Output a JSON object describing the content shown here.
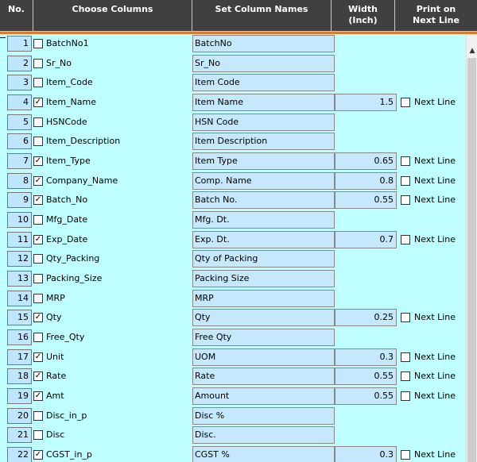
{
  "headers": {
    "no": "No.",
    "choose": "Choose Columns",
    "set_names": "Set Column Names",
    "width_l1": "Width",
    "width_l2": "(Inch)",
    "print_l1": "Print on",
    "print_l2": "Next Line"
  },
  "next_line_label": "Next Line",
  "rows": [
    {
      "no": "1",
      "checked": false,
      "column": "BatchNo1",
      "name": "BatchNo",
      "width": null
    },
    {
      "no": "2",
      "checked": false,
      "column": "Sr_No",
      "name": "Sr_No",
      "width": null
    },
    {
      "no": "3",
      "checked": false,
      "column": "Item_Code",
      "name": "Item Code",
      "width": null
    },
    {
      "no": "4",
      "checked": true,
      "column": "Item_Name",
      "name": "Item Name",
      "width": "1.5"
    },
    {
      "no": "5",
      "checked": false,
      "column": "HSNCode",
      "name": "HSN Code",
      "width": null
    },
    {
      "no": "6",
      "checked": false,
      "column": "Item_Description",
      "name": "Item Description",
      "width": null
    },
    {
      "no": "7",
      "checked": true,
      "column": "Item_Type",
      "name": "Item Type",
      "width": "0.65"
    },
    {
      "no": "8",
      "checked": true,
      "column": "Company_Name",
      "name": "Comp. Name",
      "width": "0.8"
    },
    {
      "no": "9",
      "checked": true,
      "column": "Batch_No",
      "name": "Batch No.",
      "width": "0.55"
    },
    {
      "no": "10",
      "checked": false,
      "column": "Mfg_Date",
      "name": "Mfg. Dt.",
      "width": null
    },
    {
      "no": "11",
      "checked": true,
      "column": "Exp_Date",
      "name": "Exp. Dt.",
      "width": "0.7"
    },
    {
      "no": "12",
      "checked": false,
      "column": "Qty_Packing",
      "name": "Qty of Packing",
      "width": null
    },
    {
      "no": "13",
      "checked": false,
      "column": "Packing_Size",
      "name": "Packing Size",
      "width": null
    },
    {
      "no": "14",
      "checked": false,
      "column": "MRP",
      "name": "MRP",
      "width": null
    },
    {
      "no": "15",
      "checked": true,
      "column": "Qty",
      "name": "Qty",
      "width": "0.25"
    },
    {
      "no": "16",
      "checked": false,
      "column": "Free_Qty",
      "name": "Free Qty",
      "width": null
    },
    {
      "no": "17",
      "checked": true,
      "column": "Unit",
      "name": "UOM",
      "width": "0.3"
    },
    {
      "no": "18",
      "checked": true,
      "column": "Rate",
      "name": "Rate",
      "width": "0.55"
    },
    {
      "no": "19",
      "checked": true,
      "column": "Amt",
      "name": "Amount",
      "width": "0.55"
    },
    {
      "no": "20",
      "checked": false,
      "column": "Disc_in_p",
      "name": "Disc %",
      "width": null
    },
    {
      "no": "21",
      "checked": false,
      "column": "Disc",
      "name": "Disc.",
      "width": null
    },
    {
      "no": "22",
      "checked": true,
      "column": "CGST_in_p",
      "name": "CGST %",
      "width": "0.3"
    }
  ],
  "scroll_up_icon": "triangle-up-icon"
}
